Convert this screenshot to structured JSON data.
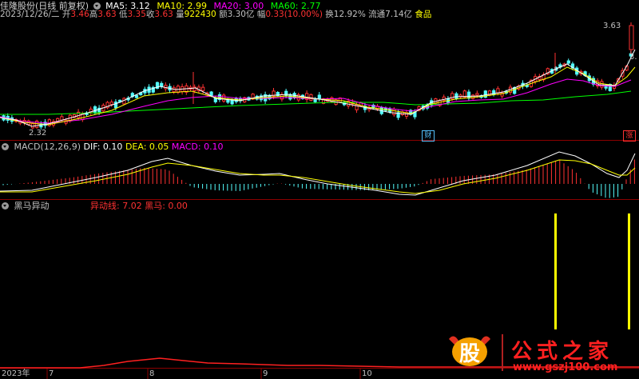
{
  "header": {
    "stock_name": "佳隆股份",
    "period_label": "(日线 前复权)",
    "ma": [
      {
        "label": "MA5: 3.12",
        "color": "#ffffff"
      },
      {
        "label": "MA10: 2.99",
        "color": "#ffff00"
      },
      {
        "label": "MA20: 3.00",
        "color": "#ff00ff"
      },
      {
        "label": "MA60: 2.77",
        "color": "#00ff00"
      }
    ]
  },
  "quote": {
    "date": "2023/12/26/二",
    "open_label": "开",
    "open": "3.46",
    "high_label": "高",
    "high": "3.63",
    "low_label": "低",
    "low": "3.35",
    "close_label": "收",
    "close": "3.63",
    "volume_label": "量",
    "volume": "922430",
    "amount_label": "额",
    "amount": "3.30亿",
    "change_label": "幅",
    "change": "0.33(10.00%)",
    "turnover_label": "换",
    "turnover": "12.92%",
    "float_label": "流通",
    "float": "7.14亿",
    "sector": "食品"
  },
  "price_panel": {
    "high_price_label": "3.63",
    "low_price_label": "2.32",
    "right_axis_label": "3.",
    "badge_cai": "财",
    "badge_zhang": "涨"
  },
  "macd_panel": {
    "title": "MACD(12,26,9)",
    "dif": "DIF: 0.10",
    "dea": "DEA: 0.05",
    "macd": "MACD: 0.10"
  },
  "heima_panel": {
    "title": "黑马异动",
    "yidong": "异动线: 7.02",
    "heima": "黑马: 0.00"
  },
  "xaxis": {
    "labels": [
      "2023年",
      "7",
      "8",
      "9",
      "10"
    ]
  },
  "watermark": {
    "icon_text": "股",
    "brand": "公式之家",
    "url": "www.gszj100.com"
  },
  "colors": {
    "up": "#ff3232",
    "down": "#54fcfc",
    "ma5": "#ffffff",
    "ma10": "#ffff00",
    "ma20": "#ff00ff",
    "ma60": "#00ff00",
    "grid": "#8b0000"
  }
}
